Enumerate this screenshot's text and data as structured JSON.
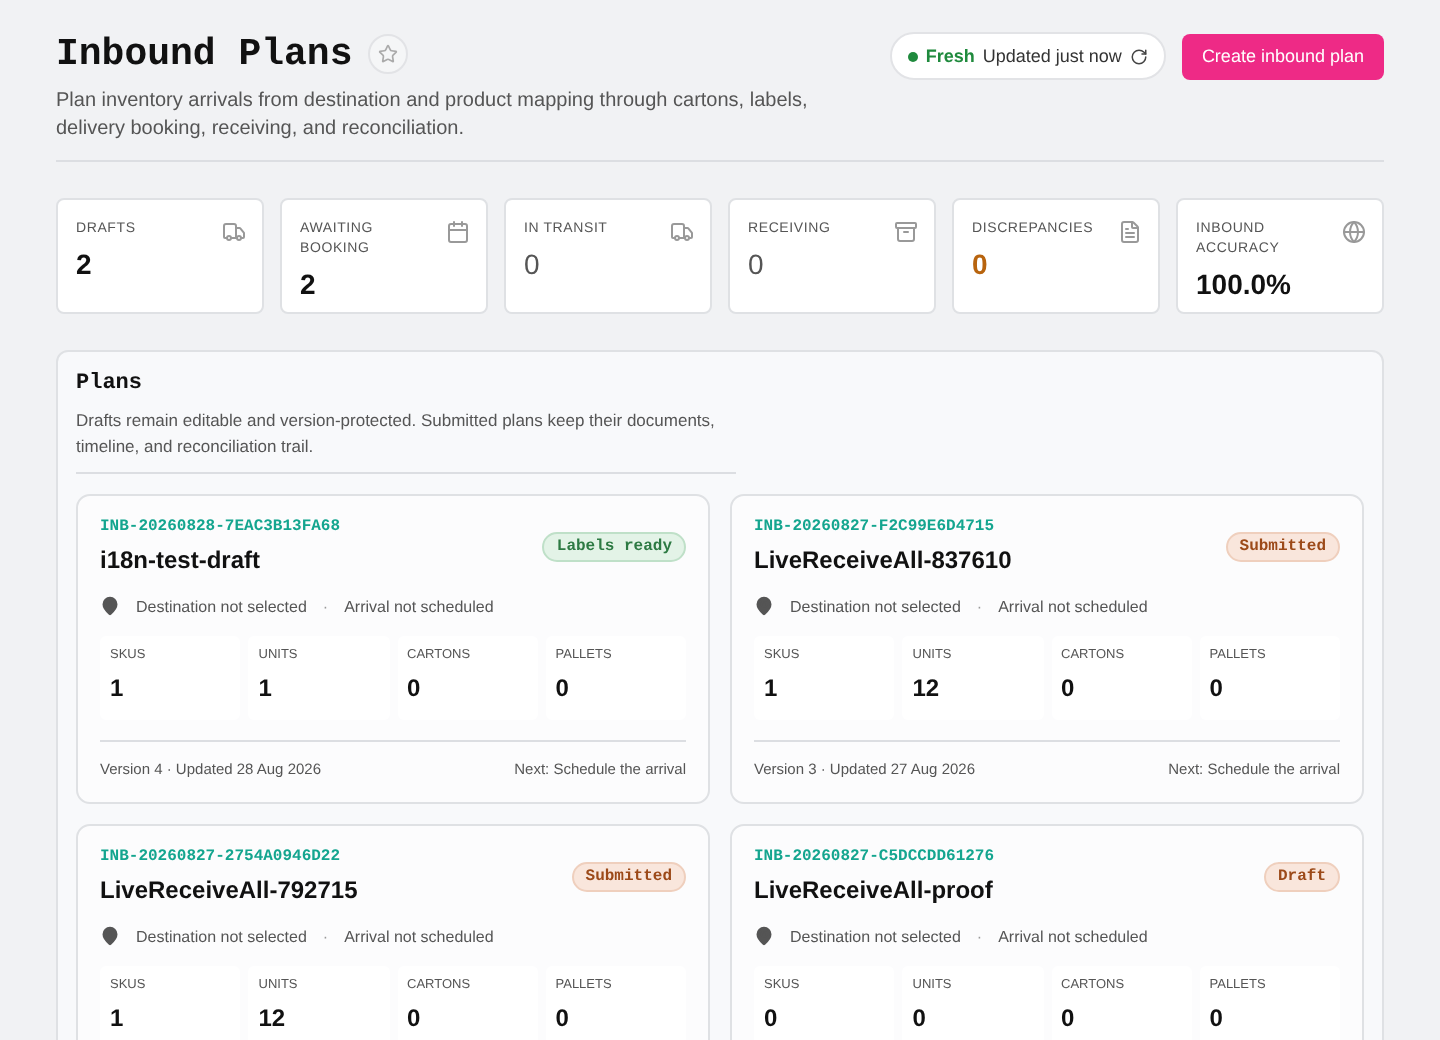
{
  "header": {
    "title": "Inbound Plans",
    "subtitle": "Plan inventory arrivals from destination and product mapping through cartons, labels, delivery booking, receiving, and reconciliation.",
    "status": {
      "label": "Fresh",
      "text": "Updated just now"
    },
    "primary_button": "Create inbound plan"
  },
  "stats": [
    {
      "label": "DRAFTS",
      "value": "2",
      "kind": "strong"
    },
    {
      "label": "AWAITING BOOKING",
      "value": "2",
      "kind": "strong"
    },
    {
      "label": "IN TRANSIT",
      "value": "0",
      "kind": "muted"
    },
    {
      "label": "RECEIVING",
      "value": "0",
      "kind": "muted"
    },
    {
      "label": "DISCREPANCIES",
      "value": "0",
      "kind": "warning"
    },
    {
      "label": "INBOUND ACCURACY",
      "value": "100.0%",
      "kind": "strong"
    }
  ],
  "plans": {
    "title": "Plans",
    "description": "Drafts remain editable and version-protected. Submitted plans keep their documents, timeline, and reconciliation trail.",
    "items": [
      {
        "id": "INB-20260828-7EAC3B13FA68",
        "name": "i18n-test-draft",
        "badge": {
          "text": "Labels ready",
          "kind": "success"
        },
        "destination": "Destination not selected",
        "separator": "·",
        "arrival": "Arrival not scheduled",
        "metrics": [
          {
            "label": "SKUS",
            "value": "1"
          },
          {
            "label": "UNITS",
            "value": "1"
          },
          {
            "label": "CARTONS",
            "value": "0"
          },
          {
            "label": "PALLETS",
            "value": "0"
          }
        ],
        "meta": "Version 4 · Updated 28 Aug 2026",
        "next": "Next: Schedule the arrival"
      },
      {
        "id": "INB-20260827-F2C99E6D4715",
        "name": "LiveReceiveAll-837610",
        "badge": {
          "text": "Submitted",
          "kind": "warning"
        },
        "destination": "Destination not selected",
        "separator": "·",
        "arrival": "Arrival not scheduled",
        "metrics": [
          {
            "label": "SKUS",
            "value": "1"
          },
          {
            "label": "UNITS",
            "value": "12"
          },
          {
            "label": "CARTONS",
            "value": "0"
          },
          {
            "label": "PALLETS",
            "value": "0"
          }
        ],
        "meta": "Version 3 · Updated 27 Aug 2026",
        "next": "Next: Schedule the arrival"
      },
      {
        "id": "INB-20260827-2754A0946D22",
        "name": "LiveReceiveAll-792715",
        "badge": {
          "text": "Submitted",
          "kind": "warning"
        },
        "destination": "Destination not selected",
        "separator": "·",
        "arrival": "Arrival not scheduled",
        "metrics": [
          {
            "label": "SKUS",
            "value": "1"
          },
          {
            "label": "UNITS",
            "value": "12"
          },
          {
            "label": "CARTONS",
            "value": "0"
          },
          {
            "label": "PALLETS",
            "value": "0"
          }
        ]
      },
      {
        "id": "INB-20260827-C5DCCDD61276",
        "name": "LiveReceiveAll-proof",
        "badge": {
          "text": "Draft",
          "kind": "warning"
        },
        "destination": "Destination not selected",
        "separator": "·",
        "arrival": "Arrival not scheduled",
        "metrics": [
          {
            "label": "SKUS",
            "value": "0"
          },
          {
            "label": "UNITS",
            "value": "0"
          },
          {
            "label": "CARTONS",
            "value": "0"
          },
          {
            "label": "PALLETS",
            "value": "0"
          }
        ]
      }
    ]
  }
}
